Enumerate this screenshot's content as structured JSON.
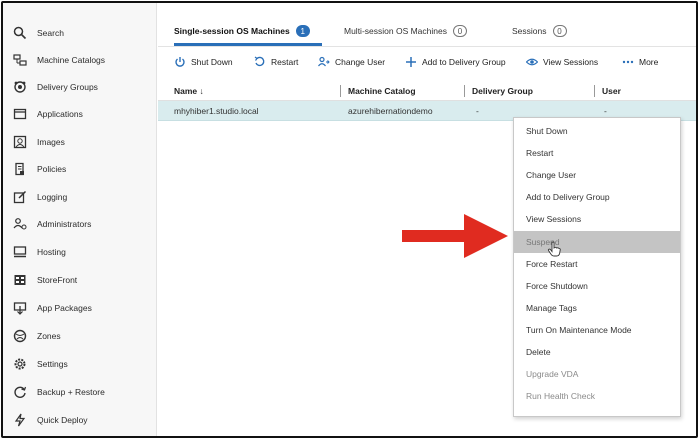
{
  "sidebar": {
    "items": [
      {
        "label": "Search",
        "icon": "search-icon"
      },
      {
        "label": "Machine Catalogs",
        "icon": "machine-catalogs-icon"
      },
      {
        "label": "Delivery Groups",
        "icon": "delivery-groups-icon"
      },
      {
        "label": "Applications",
        "icon": "applications-icon"
      },
      {
        "label": "Images",
        "icon": "images-icon"
      },
      {
        "label": "Policies",
        "icon": "policies-icon"
      },
      {
        "label": "Logging",
        "icon": "logging-icon"
      },
      {
        "label": "Administrators",
        "icon": "administrators-icon"
      },
      {
        "label": "Hosting",
        "icon": "hosting-icon"
      },
      {
        "label": "StoreFront",
        "icon": "storefront-icon"
      },
      {
        "label": "App Packages",
        "icon": "app-packages-icon"
      },
      {
        "label": "Zones",
        "icon": "zones-icon"
      },
      {
        "label": "Settings",
        "icon": "settings-icon"
      },
      {
        "label": "Backup + Restore",
        "icon": "backup-restore-icon"
      },
      {
        "label": "Quick Deploy",
        "icon": "quick-deploy-icon"
      }
    ]
  },
  "tabs": [
    {
      "label": "Single-session OS Machines",
      "count": "1",
      "active": true
    },
    {
      "label": "Multi-session OS Machines",
      "count": "0",
      "active": false
    },
    {
      "label": "Sessions",
      "count": "0",
      "active": false
    }
  ],
  "toolbar": {
    "shut_down": "Shut Down",
    "restart": "Restart",
    "change_user": "Change User",
    "add_to_delivery_group": "Add to Delivery Group",
    "view_sessions": "View Sessions",
    "more": "More"
  },
  "table": {
    "headers": {
      "name": "Name ↓",
      "machine_catalog": "Machine Catalog",
      "delivery_group": "Delivery Group",
      "user": "User"
    },
    "rows": [
      {
        "name": "mhyhiber1.studio.local",
        "machine_catalog": "azurehibernationdemo",
        "delivery_group": "-",
        "user": "-"
      }
    ]
  },
  "context_menu": {
    "items": [
      {
        "label": "Shut Down",
        "state": "normal"
      },
      {
        "label": "Restart",
        "state": "normal"
      },
      {
        "label": "Change User",
        "state": "normal"
      },
      {
        "label": "Add to Delivery Group",
        "state": "normal"
      },
      {
        "label": "View Sessions",
        "state": "normal"
      },
      {
        "label": "Suspend",
        "state": "hover"
      },
      {
        "label": "Force Restart",
        "state": "normal"
      },
      {
        "label": "Force Shutdown",
        "state": "normal"
      },
      {
        "label": "Manage Tags",
        "state": "normal"
      },
      {
        "label": "Turn On Maintenance Mode",
        "state": "normal"
      },
      {
        "label": "Delete",
        "state": "normal"
      },
      {
        "label": "Upgrade VDA",
        "state": "disabled"
      },
      {
        "label": "Run Health Check",
        "state": "disabled"
      }
    ]
  },
  "colors": {
    "accent": "#2a6fb8",
    "selected_row": "#d9ecee",
    "menu_hover": "#c4c4c4",
    "annotation_arrow": "#e02b20"
  }
}
